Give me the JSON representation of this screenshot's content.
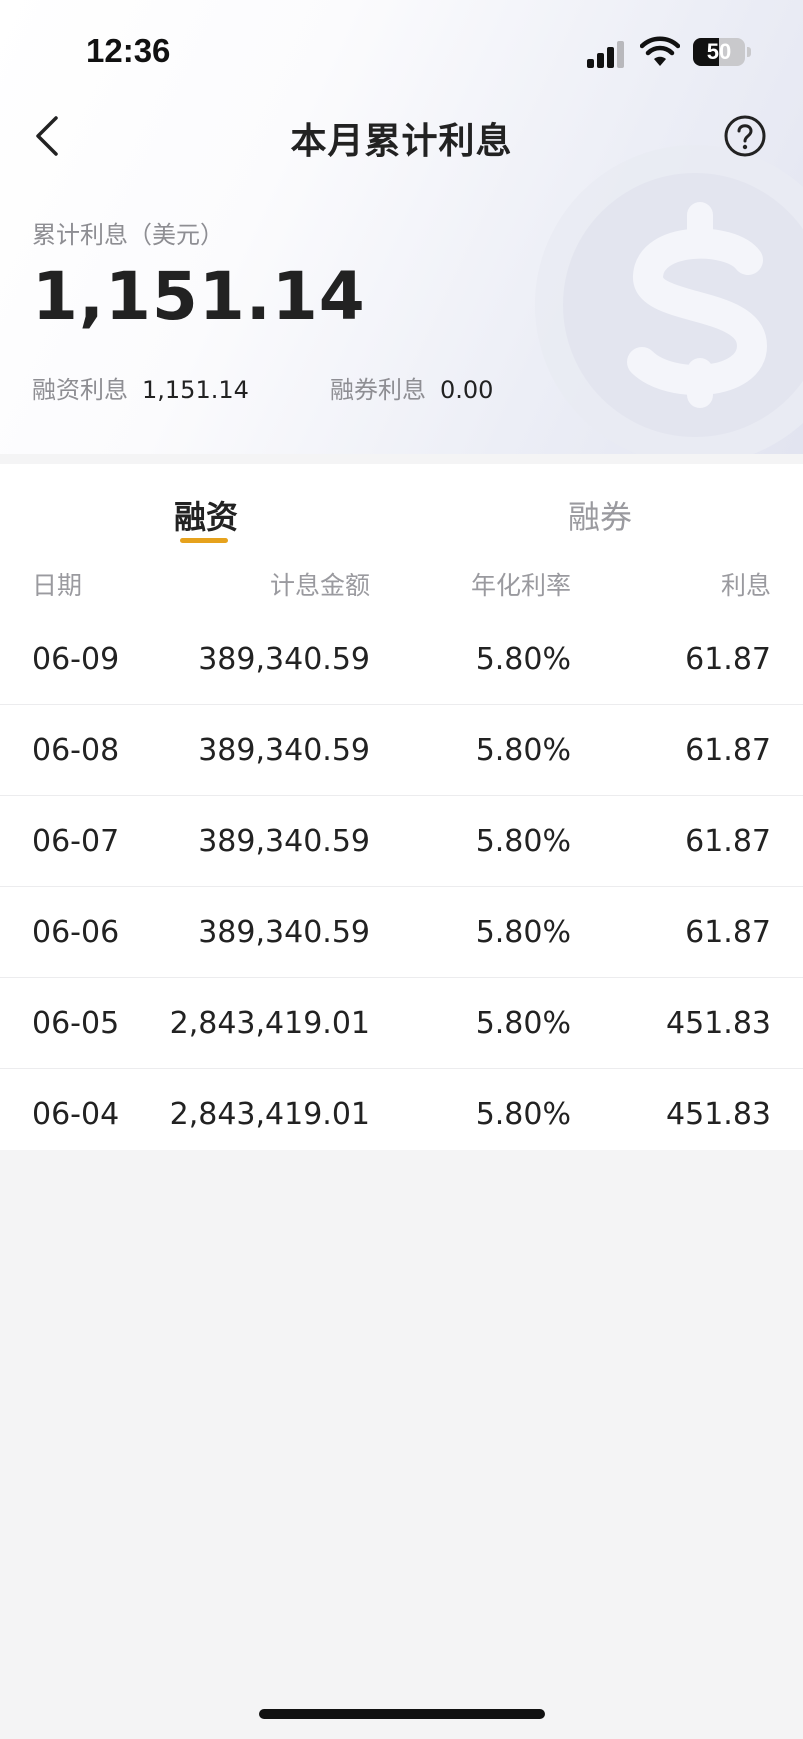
{
  "status_bar": {
    "time": "12:36",
    "battery": "50"
  },
  "nav": {
    "title": "本月累计利息",
    "back_icon": "chevron-left-icon",
    "help_icon": "question-circle-icon"
  },
  "summary": {
    "label": "累计利息（美元）",
    "total": "1,151.14",
    "financing_label": "融资利息",
    "financing_value": "1,151.14",
    "securities_label": "融券利息",
    "securities_value": "0.00"
  },
  "tabs": [
    {
      "label": "融资",
      "active": true
    },
    {
      "label": "融券",
      "active": false
    }
  ],
  "table": {
    "headers": [
      "日期",
      "计息金额",
      "年化利率",
      "利息"
    ],
    "rows": [
      [
        "06-09",
        "389,340.59",
        "5.80%",
        "61.87"
      ],
      [
        "06-08",
        "389,340.59",
        "5.80%",
        "61.87"
      ],
      [
        "06-07",
        "389,340.59",
        "5.80%",
        "61.87"
      ],
      [
        "06-06",
        "389,340.59",
        "5.80%",
        "61.87"
      ],
      [
        "06-05",
        "2,843,419.01",
        "5.80%",
        "451.83"
      ],
      [
        "06-04",
        "2,843,419.01",
        "5.80%",
        "451.83"
      ]
    ]
  },
  "colors": {
    "accent": "#e6a21d",
    "text_primary": "#222222",
    "text_secondary": "#8e8e93",
    "page_background": "#f4f4f5"
  }
}
